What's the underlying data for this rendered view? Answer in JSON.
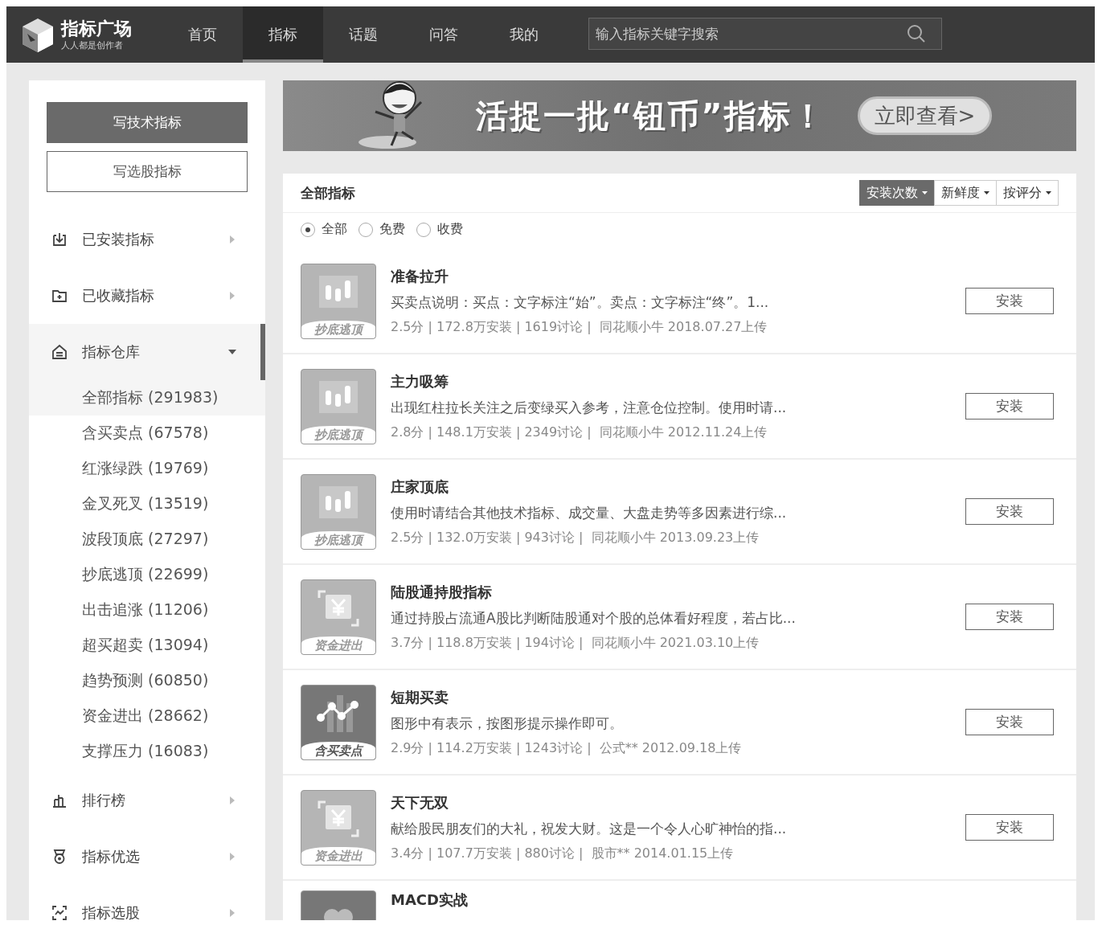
{
  "nav": {
    "logo_title": "指标广场",
    "logo_subtitle": "人人都是创作者",
    "tabs": [
      {
        "label": "首页",
        "selected": false
      },
      {
        "label": "指标",
        "selected": true
      },
      {
        "label": "话题",
        "selected": false
      },
      {
        "label": "问答",
        "selected": false
      },
      {
        "label": "我的",
        "selected": false
      }
    ],
    "search": {
      "placeholder": "输入指标关键字搜索"
    }
  },
  "sidebar": {
    "buttons": [
      {
        "label": "写技术指标",
        "kind": "primary"
      },
      {
        "label": "写选股指标",
        "kind": "outline"
      }
    ],
    "items": [
      {
        "label": "已安装指标",
        "kind": "download",
        "expanded": false
      },
      {
        "label": "已收藏指标",
        "kind": "folder",
        "expanded": false
      },
      {
        "label": "指标仓库",
        "kind": "warehouse",
        "expanded": true,
        "children": [
          {
            "label": "全部指标 (291983)",
            "selected": true
          },
          {
            "label": "含买卖点 (67578)",
            "selected": false
          },
          {
            "label": "红涨绿跌 (19769)",
            "selected": false
          },
          {
            "label": "金叉死叉 (13519)",
            "selected": false
          },
          {
            "label": "波段顶底 (27297)",
            "selected": false
          },
          {
            "label": "抄底逃顶 (22699)",
            "selected": false
          },
          {
            "label": "出击追涨 (11206)",
            "selected": false
          },
          {
            "label": "超买超卖 (13094)",
            "selected": false
          },
          {
            "label": "趋势预测 (60850)",
            "selected": false
          },
          {
            "label": "资金进出 (28662)",
            "selected": false
          },
          {
            "label": "支撑压力 (16083)",
            "selected": false
          }
        ]
      },
      {
        "label": "排行榜",
        "kind": "chart",
        "expanded": false
      },
      {
        "label": "指标优选",
        "kind": "medal",
        "expanded": false
      },
      {
        "label": "指标选股",
        "kind": "scan",
        "expanded": false
      }
    ]
  },
  "banner": {
    "headline": "活捉一批“钮币”指标！",
    "button": "立即查看>"
  },
  "list": {
    "title": "全部指标",
    "sorts": [
      {
        "label": "安装次数",
        "selected": true
      },
      {
        "label": "新鲜度",
        "selected": false
      },
      {
        "label": "按评分",
        "selected": false
      }
    ],
    "filters": [
      {
        "label": "全部",
        "selected": true
      },
      {
        "label": "免费",
        "selected": false
      },
      {
        "label": "收费",
        "selected": false
      }
    ],
    "items": [
      {
        "name": "准备拉升",
        "kind": "candles",
        "tag": "抄底逃顶",
        "description": "买卖点说明：买点：文字标注“始”。卖点：文字标注“终”。1...",
        "meta": "2.5分 | 172.8万安装 | 1619讨论 |  同花顺小牛 2018.07.27上传",
        "button": "安装"
      },
      {
        "name": "主力吸筹",
        "kind": "candles",
        "tag": "抄底逃顶",
        "description": "出现红柱拉长关注之后变绿买入参考，注意仓位控制。使用时请...",
        "meta": "2.8分 | 148.1万安装 | 2349讨论 |  同花顺小牛 2012.11.24上传",
        "button": "安装"
      },
      {
        "name": "庄家顶底",
        "kind": "candles",
        "tag": "抄底逃顶",
        "description": "使用时请结合其他技术指标、成交量、大盘走势等多因素进行综...",
        "meta": "2.5分 | 132.0万安装 | 943讨论 |  同花顺小牛 2013.09.23上传",
        "button": "安装"
      },
      {
        "name": "陆股通持股指标",
        "kind": "yuan",
        "tag": "资金进出",
        "description": "通过持股占流通A股比判断陆股通对个股的总体看好程度，若占比...",
        "meta": "3.7分 | 118.8万安装 | 194讨论 |  同花顺小牛 2021.03.10上传",
        "button": "安装"
      },
      {
        "name": "短期买卖",
        "kind": "dots",
        "tag": "含买卖点",
        "description": "图形中有表示，按图形提示操作即可。",
        "meta": "2.9分 | 114.2万安装 | 1243讨论 |  公式** 2012.09.18上传",
        "button": "安装"
      },
      {
        "name": "天下无双",
        "kind": "yuan",
        "tag": "资金进出",
        "description": "献给股民朋友们的大礼，祝发大财。这是一个令人心旷神怡的指...",
        "meta": "3.4分 | 107.7万安装 | 880讨论 |  股市** 2014.01.15上传",
        "button": "安装"
      },
      {
        "name": "MACD实战",
        "kind": "circles"
      }
    ]
  }
}
